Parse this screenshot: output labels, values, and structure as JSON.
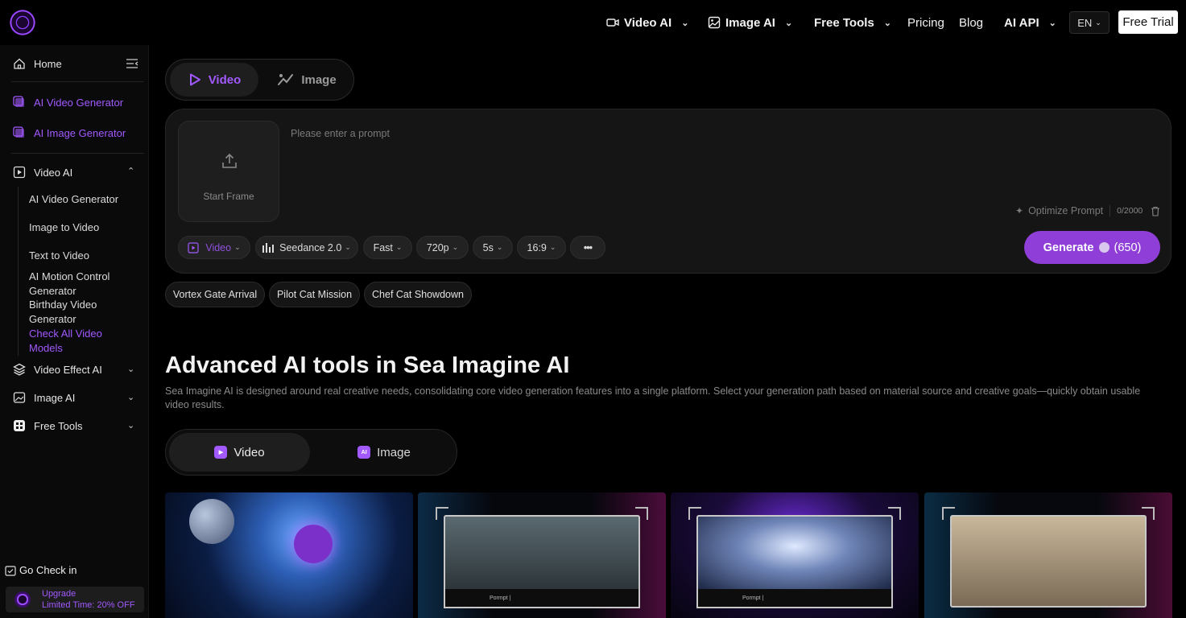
{
  "header": {
    "nav": [
      {
        "label": "Video AI",
        "bold": true,
        "dropdown": true,
        "icon": "video-camera-icon"
      },
      {
        "label": "Image AI",
        "bold": true,
        "dropdown": true,
        "icon": "image-icon"
      },
      {
        "label": "Free Tools",
        "bold": true,
        "dropdown": true
      },
      {
        "label": "Pricing",
        "bold": false,
        "dropdown": false
      },
      {
        "label": "Blog",
        "bold": false,
        "dropdown": false
      },
      {
        "label": "AI API",
        "bold": true,
        "dropdown": true
      }
    ],
    "lang": "EN",
    "free_trial": "Free Trial"
  },
  "sidebar": {
    "home": "Home",
    "featured": [
      "AI Video Generator",
      "AI Image Generator"
    ],
    "video_ai": {
      "label": "Video AI",
      "items": [
        "AI Video Generator",
        "Image to Video",
        "Text to Video",
        "AI Motion Control Generator",
        "Birthday Video Generator",
        "Check All Video Models"
      ]
    },
    "sections": [
      "Video Effect AI",
      "Image AI",
      "Free Tools"
    ],
    "go_check_in": "Go Check in",
    "upgrade_title": "Upgrade",
    "upgrade_subtitle": "Limited Time: 20% OFF"
  },
  "mode_toggle": {
    "active": "Video",
    "inactive": "Image"
  },
  "composer": {
    "start_frame": "Start Frame",
    "prompt_placeholder": "Please enter a prompt",
    "optimize": "Optimize Prompt",
    "char_count": "0/2000",
    "options": {
      "type": "Video",
      "model": "Seedance 2.0",
      "speed": "Fast",
      "resolution": "720p",
      "duration": "5s",
      "ratio": "16:9",
      "more": "•••"
    },
    "generate": "Generate",
    "credits": "(650)"
  },
  "suggestions": [
    "Vortex Gate Arrival",
    "Pilot Cat Mission",
    "Chef Cat Showdown"
  ],
  "section": {
    "title": "Advanced AI tools in Sea Imagine AI",
    "description": "Sea Imagine AI is designed around real creative needs, consolidating core video generation features into a single platform. Select your generation path based on material source and creative goals—quickly obtain usable video results."
  },
  "tools_toggle": {
    "active": "Video",
    "inactive": "Image",
    "image_badge": "AI"
  },
  "cards": {
    "prompt_label": "Pormpt  |"
  },
  "colors": {
    "accent": "#a259ff",
    "generate_bg": "#8f3fd8",
    "background": "#000000"
  }
}
